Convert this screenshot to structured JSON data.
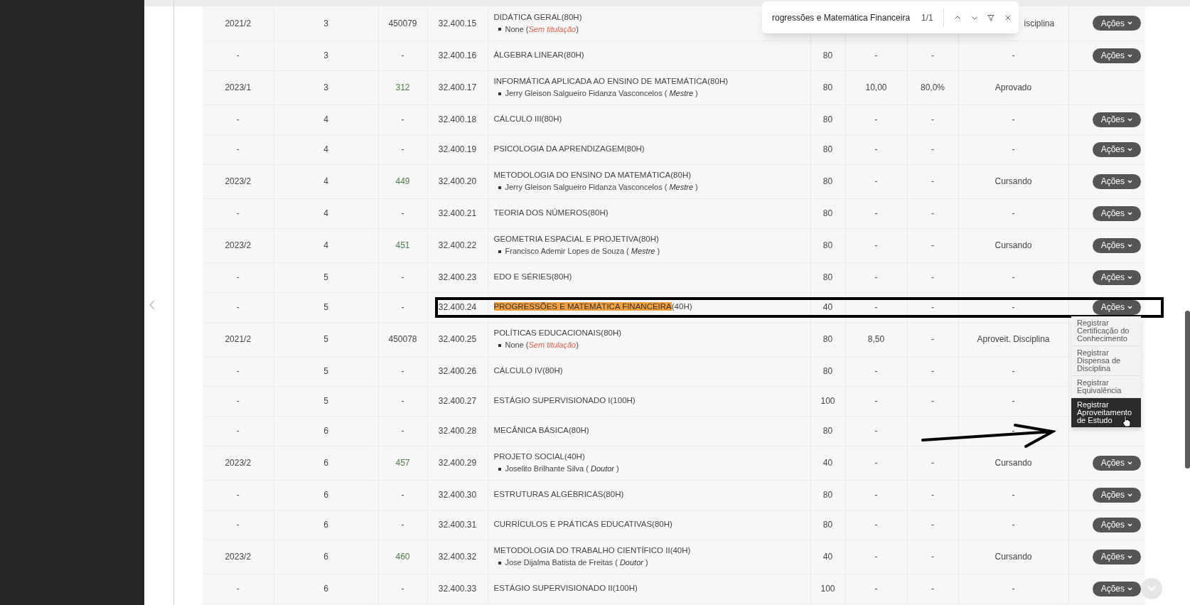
{
  "find_bar": {
    "query": "rogressões e Matemática Financeira",
    "count": "1/1"
  },
  "rows": [
    {
      "year": "2021/2",
      "period": "3",
      "turma": {
        "text": "450079",
        "link": false
      },
      "code": "32.400.15",
      "name": "DIDÁTICA GERAL(80H)",
      "teacher": "None (*Sem titulação*)",
      "teacher_missing": true,
      "situacao": "isciplina",
      "actions": "Ações"
    },
    {
      "year": "-",
      "period": "3",
      "turma": {
        "text": "-",
        "link": false
      },
      "code": "32.400.16",
      "name": "ÁLGEBRA LINEAR(80H)",
      "ch": "80",
      "nota": "-",
      "freq": "-",
      "situacao": "-",
      "actions": "Ações"
    },
    {
      "year": "2023/1",
      "period": "3",
      "turma": {
        "text": "312",
        "link": true
      },
      "code": "32.400.17",
      "name": "INFORMÁTICA APLICADA AO ENSINO DE MATEMÁTICA(80H)",
      "teacher": "Jerry Gleison Salgueiro Fidanza Vasconcelos ( *Mestre* )",
      "teacher_missing": false,
      "ch": "80",
      "nota": "10,00",
      "freq": "80,0%",
      "situacao": "Aprovado"
    },
    {
      "year": "-",
      "period": "4",
      "turma": {
        "text": "-",
        "link": false
      },
      "code": "32.400.18",
      "name": "CÁLCULO III(80H)",
      "ch": "80",
      "nota": "-",
      "freq": "-",
      "situacao": "-",
      "actions": "Ações"
    },
    {
      "year": "-",
      "period": "4",
      "turma": {
        "text": "-",
        "link": false
      },
      "code": "32.400.19",
      "name": "PSICOLOGIA DA APRENDIZAGEM(80H)",
      "ch": "80",
      "nota": "-",
      "freq": "-",
      "situacao": "-",
      "actions": "Ações"
    },
    {
      "year": "2023/2",
      "period": "4",
      "turma": {
        "text": "449",
        "link": true
      },
      "code": "32.400.20",
      "name": "METODOLOGIA DO ENSINO DA MATEMÁTICA(80H)",
      "teacher": "Jerry Gleison Salgueiro Fidanza Vasconcelos ( *Mestre* )",
      "teacher_missing": false,
      "ch": "80",
      "nota": "-",
      "freq": "-",
      "situacao": "Cursando",
      "actions": "Ações"
    },
    {
      "year": "-",
      "period": "4",
      "turma": {
        "text": "-",
        "link": false
      },
      "code": "32.400.21",
      "name": "TEORIA DOS NÚMEROS(80H)",
      "ch": "80",
      "nota": "-",
      "freq": "-",
      "situacao": "-",
      "actions": "Ações"
    },
    {
      "year": "2023/2",
      "period": "4",
      "turma": {
        "text": "451",
        "link": true
      },
      "code": "32.400.22",
      "name": "GEOMETRIA ESPACIAL E PROJETIVA(80H)",
      "teacher": "Francisco Ademir Lopes de Souza ( *Mestre* )",
      "teacher_missing": false,
      "ch": "80",
      "nota": "-",
      "freq": "-",
      "situacao": "Cursando",
      "actions": "Ações"
    },
    {
      "year": "-",
      "period": "5",
      "turma": {
        "text": "-",
        "link": false
      },
      "code": "32.400.23",
      "name": "EDO E SÉRIES(80H)",
      "ch": "80",
      "nota": "-",
      "freq": "-",
      "situacao": "-",
      "actions": "Ações"
    },
    {
      "year": "-",
      "period": "5",
      "turma": {
        "text": "-",
        "link": false
      },
      "code": "32.400.24",
      "match": "PROGRESSÕES E MATEMÁTICA FINANCEIRA",
      "name": "(40H)",
      "ch": "40",
      "nota": "-",
      "freq": "-",
      "situacao": "-",
      "actions": "Ações",
      "menu": [
        {
          "label": "Registrar Certificação do Conhecimento",
          "selected": false
        },
        {
          "label": "Registrar Dispensa de Disciplina",
          "selected": false
        },
        {
          "label": "Registrar Equivalência",
          "selected": false
        },
        {
          "label": "Registrar Aproveitamento de Estudo",
          "selected": true
        }
      ]
    },
    {
      "year": "2021/2",
      "period": "5",
      "turma": {
        "text": "450078",
        "link": false
      },
      "code": "32.400.25",
      "name": "POLÍTICAS EDUCACIONAIS(80H)",
      "teacher": "None (*Sem titulação*)",
      "teacher_missing": true,
      "ch": "80",
      "nota": "8,50",
      "freq": "-",
      "situacao": "Aproveit. Disciplina"
    },
    {
      "year": "-",
      "period": "5",
      "turma": {
        "text": "-",
        "link": false
      },
      "code": "32.400.26",
      "name": "CÁLCULO IV(80H)",
      "ch": "80",
      "nota": "-",
      "freq": "-",
      "situacao": "-"
    },
    {
      "year": "-",
      "period": "5",
      "turma": {
        "text": "-",
        "link": false
      },
      "code": "32.400.27",
      "name": "ESTÁGIO SUPERVISIONADO I(100H)",
      "ch": "100",
      "nota": "-",
      "freq": "-",
      "situacao": "-"
    },
    {
      "year": "-",
      "period": "6",
      "turma": {
        "text": "-",
        "link": false
      },
      "code": "32.400.28",
      "name": "MECÂNICA BÁSICA(80H)",
      "ch": "80",
      "nota": "-",
      "situacao": "-"
    },
    {
      "year": "2023/2",
      "period": "6",
      "turma": {
        "text": "457",
        "link": true
      },
      "code": "32.400.29",
      "name": "PROJETO SOCIAL(40H)",
      "teacher": "Joselito Brilhante Silva ( *Doutor* )",
      "teacher_missing": false,
      "ch": "40",
      "nota": "-",
      "freq": "-",
      "situacao": "Cursando",
      "actions": "Ações"
    },
    {
      "year": "-",
      "period": "6",
      "turma": {
        "text": "-",
        "link": false
      },
      "code": "32.400.30",
      "name": "ESTRUTURAS ALGÉBRICAS(80H)",
      "ch": "80",
      "nota": "-",
      "freq": "-",
      "situacao": "-",
      "actions": "Ações"
    },
    {
      "year": "-",
      "period": "6",
      "turma": {
        "text": "-",
        "link": false
      },
      "code": "32.400.31",
      "name": "CURRÍCULOS E PRÁTICAS EDUCATIVAS(80H)",
      "ch": "80",
      "nota": "-",
      "freq": "-",
      "situacao": "-",
      "actions": "Ações"
    },
    {
      "year": "2023/2",
      "period": "6",
      "turma": {
        "text": "460",
        "link": true
      },
      "code": "32.400.32",
      "name": "METODOLOGIA DO TRABALHO CIENTÍFICO II(40H)",
      "teacher": "Jose Dijalma Batista de Freitas ( *Doutor* )",
      "teacher_missing": false,
      "ch": "40",
      "nota": "-",
      "freq": "-",
      "situacao": "Cursando",
      "actions": "Ações"
    },
    {
      "year": "-",
      "period": "6",
      "turma": {
        "text": "-",
        "link": false
      },
      "code": "32.400.33",
      "name": "ESTÁGIO SUPERVISIONADO II(100H)",
      "ch": "100",
      "nota": "-",
      "freq": "-",
      "situacao": "-",
      "actions": "Ações"
    }
  ]
}
